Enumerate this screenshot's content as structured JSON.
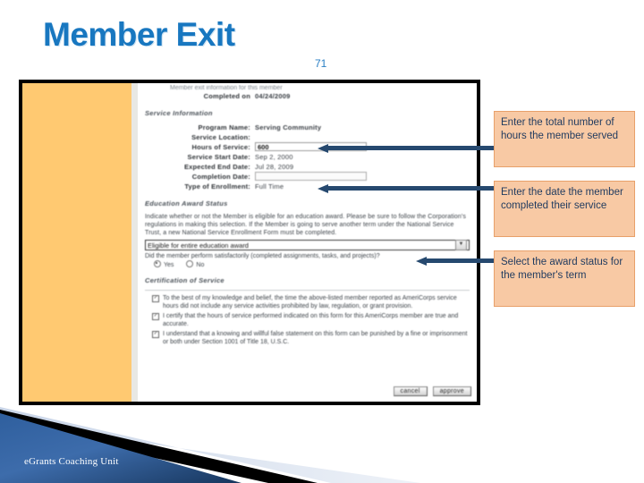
{
  "slide": {
    "title": "Member Exit",
    "number": "71",
    "footer": "eGrants Coaching Unit"
  },
  "colors": {
    "title_blue": "#1877c0",
    "arrow_navy": "#26496f",
    "callout_fill": "#f8c9a4",
    "callout_border": "#e8a06a",
    "sidebar_orange": "#ffc971",
    "banner_blue": "#2c5d9b"
  },
  "screenshot": {
    "clipped_top_line": "Member exit information for this member",
    "completed_on": {
      "label": "Completed on",
      "value": "04/24/2009"
    },
    "service_information": {
      "heading": "Service Information",
      "fields": [
        {
          "label": "Program Name:",
          "value": "Serving Community",
          "type": "text",
          "bold": true
        },
        {
          "label": "Service Location:",
          "value": "",
          "type": "text",
          "bold": false
        },
        {
          "label": "Hours of Service:",
          "value": "600",
          "type": "input"
        },
        {
          "label": "Service Start Date:",
          "value": "Sep 2, 2000",
          "type": "text",
          "bold": false
        },
        {
          "label": "Expected End Date:",
          "value": "Jul 28, 2009",
          "type": "text",
          "bold": false
        },
        {
          "label": "Completion Date:",
          "value": "",
          "type": "input"
        },
        {
          "label": "Type of Enrollment:",
          "value": "Full Time",
          "type": "text",
          "bold": false
        }
      ]
    },
    "education_award_status": {
      "heading": "Education Award Status",
      "instructions": "Indicate whether or not the Member is eligible for an education award. Please be sure to follow the Corporation's regulations in making this selection. If the Member is going to serve another term under the National Service Trust, a new National Service Enrollment Form must be completed.",
      "dropdown_value": "Eligible for entire education award",
      "dropdown_icon": "chevron-down-icon",
      "question": "Did the member perform satisfactorily (completed assignments, tasks, and projects)?",
      "radio_yes": "Yes",
      "radio_no": "No",
      "radio_selected": "Yes"
    },
    "certification_of_service": {
      "heading": "Certification of Service",
      "checkboxes": [
        "To the best of my knowledge and belief, the time the above-listed member reported as AmeriCorps service hours did not include any service activities prohibited by law, regulation, or grant provision.",
        "I certify that the hours of service performed indicated on this form for this AmeriCorps member are true and accurate.",
        "I understand that a knowing and willful false statement on this form can be punished by a fine or imprisonment or both under Section 1001 of Title 18, U.S.C."
      ]
    },
    "buttons": {
      "cancel": "cancel",
      "approve": "approve"
    }
  },
  "callouts": [
    {
      "id": "hours",
      "text": "Enter the total number of hours the member served"
    },
    {
      "id": "date",
      "text": "Enter the date the member completed their service"
    },
    {
      "id": "award",
      "text": "Select the award status for the member's term"
    }
  ]
}
